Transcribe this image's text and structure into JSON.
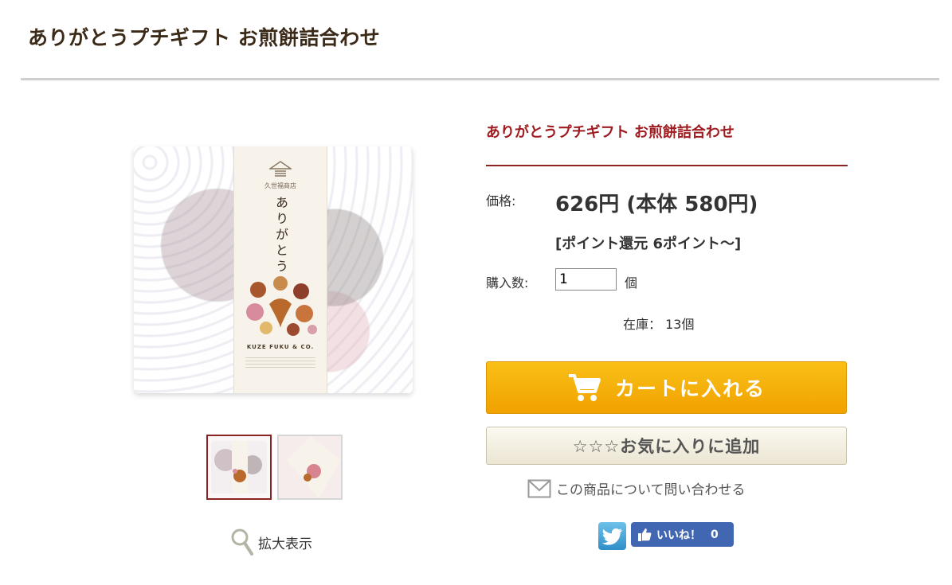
{
  "header": {
    "title": "ありがとうプチギフト お煎餅詰合わせ"
  },
  "product": {
    "name": "ありがとうプチギフト お煎餅詰合わせ",
    "price_label": "価格:",
    "price_value": "626円 (本体 580円)",
    "points": "[ポイント還元 6ポイント〜]",
    "quantity_label": "購入数:",
    "quantity_value": "1",
    "quantity_unit": "個",
    "stock": "在庫： 13個"
  },
  "package": {
    "shop_name": "久世福商店",
    "vertical_text": "ありがとう",
    "brand": "KUZE FUKU & CO."
  },
  "gallery": {
    "zoom_label": "拡大表示"
  },
  "actions": {
    "cart_label": "カートに入れる",
    "favorite_label": "☆☆☆お気に入りに追加",
    "inquiry_label": "この商品について問い合わせる"
  },
  "social": {
    "like_label": "いいね！",
    "like_count": "0"
  },
  "colors": {
    "accent": "#9e1b20",
    "cart": "#f1a100",
    "facebook": "#4267b2",
    "twitter": "#2f8fc8"
  },
  "icons": [
    "cart-icon",
    "envelope-icon",
    "magnifier-icon",
    "twitter-bird-icon",
    "thumbs-up-icon",
    "house-logo-icon"
  ]
}
